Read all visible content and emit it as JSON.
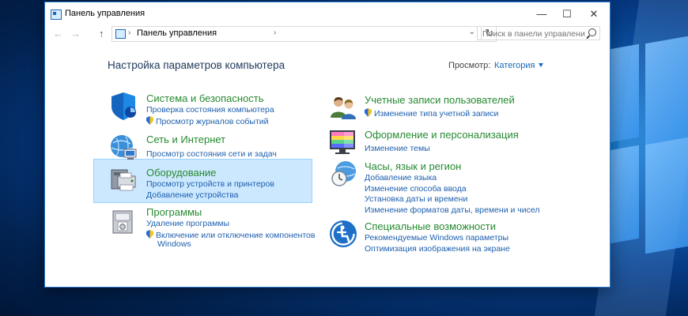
{
  "window": {
    "title": "Панель управления"
  },
  "titlebar": {
    "minimize": "—",
    "maximize": "☐",
    "close": "✕"
  },
  "nav": {
    "back": "←",
    "forward": "→",
    "up": "↑",
    "address": "Панель управления",
    "search_placeholder": "Поиск в панели управления"
  },
  "header": {
    "title": "Настройка параметров компьютера",
    "view_label": "Просмотр:",
    "view_value": "Категория"
  },
  "left": [
    {
      "title": "Система и безопасность",
      "links": [
        "Проверка состояния компьютера",
        "Просмотр журналов событий"
      ]
    },
    {
      "title": "Сеть и Интернет",
      "links": [
        "Просмотр состояния сети и задач"
      ]
    },
    {
      "title": "Оборудование",
      "links": [
        "Просмотр устройств и принтеров",
        "Добавление устройства"
      ]
    },
    {
      "title": "Программы",
      "links": [
        "Удаление программы",
        "Включение или отключение компонентов",
        "Windows"
      ]
    }
  ],
  "right": [
    {
      "title": "Учетные записи пользователей",
      "links": [
        "Изменение типа учетной записи"
      ]
    },
    {
      "title": "Оформление и персонализация",
      "links": [
        "Изменение темы"
      ]
    },
    {
      "title": "Часы, язык и регион",
      "links": [
        "Добавление языка",
        "Изменение способа ввода",
        "Установка даты и времени",
        "Изменение форматов даты, времени и чисел"
      ]
    },
    {
      "title": "Специальные возможности",
      "links": [
        "Рекомендуемые Windows параметры",
        "Оптимизация изображения на экране"
      ]
    }
  ],
  "icons": {
    "system": "shield-icon",
    "network": "globe-network-icon",
    "hardware": "printer-icon",
    "programs": "programs-box-icon",
    "users": "users-icon",
    "appearance": "monitor-colors-icon",
    "clock": "clock-globe-icon",
    "access": "ease-of-access-icon"
  },
  "colors": {
    "category_title": "#268a30",
    "link": "#1d5fae",
    "heading": "#1e395b",
    "selection": "#cce8ff"
  }
}
